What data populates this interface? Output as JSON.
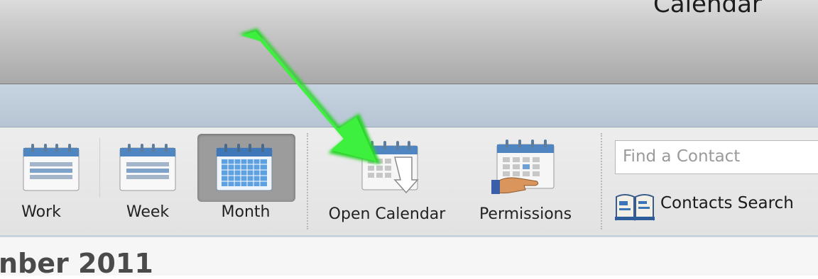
{
  "window": {
    "title": "Calendar"
  },
  "toolbar": {
    "views": [
      {
        "label": "Work",
        "icon": "calendar-work-week-icon",
        "active": false
      },
      {
        "label": "Week",
        "icon": "calendar-week-icon",
        "active": false
      },
      {
        "label": "Month",
        "icon": "calendar-month-icon",
        "active": true
      }
    ],
    "open_calendar": {
      "label": "Open Calendar",
      "icon": "open-calendar-icon"
    },
    "permissions": {
      "label": "Permissions",
      "icon": "permissions-icon"
    },
    "find_contact": {
      "placeholder": "Find a Contact"
    },
    "contacts_search": {
      "label": "Contacts Search",
      "icon": "address-book-icon"
    }
  },
  "calendar": {
    "month_heading_partial": "nber 2011"
  },
  "annotation": {
    "arrow_color": "#2ee02e"
  },
  "colors": {
    "active_view_bg": "#9c9c9c",
    "ribbon_bg": "#e6e6e6",
    "tabstrip_bg": "#c0cedc"
  }
}
